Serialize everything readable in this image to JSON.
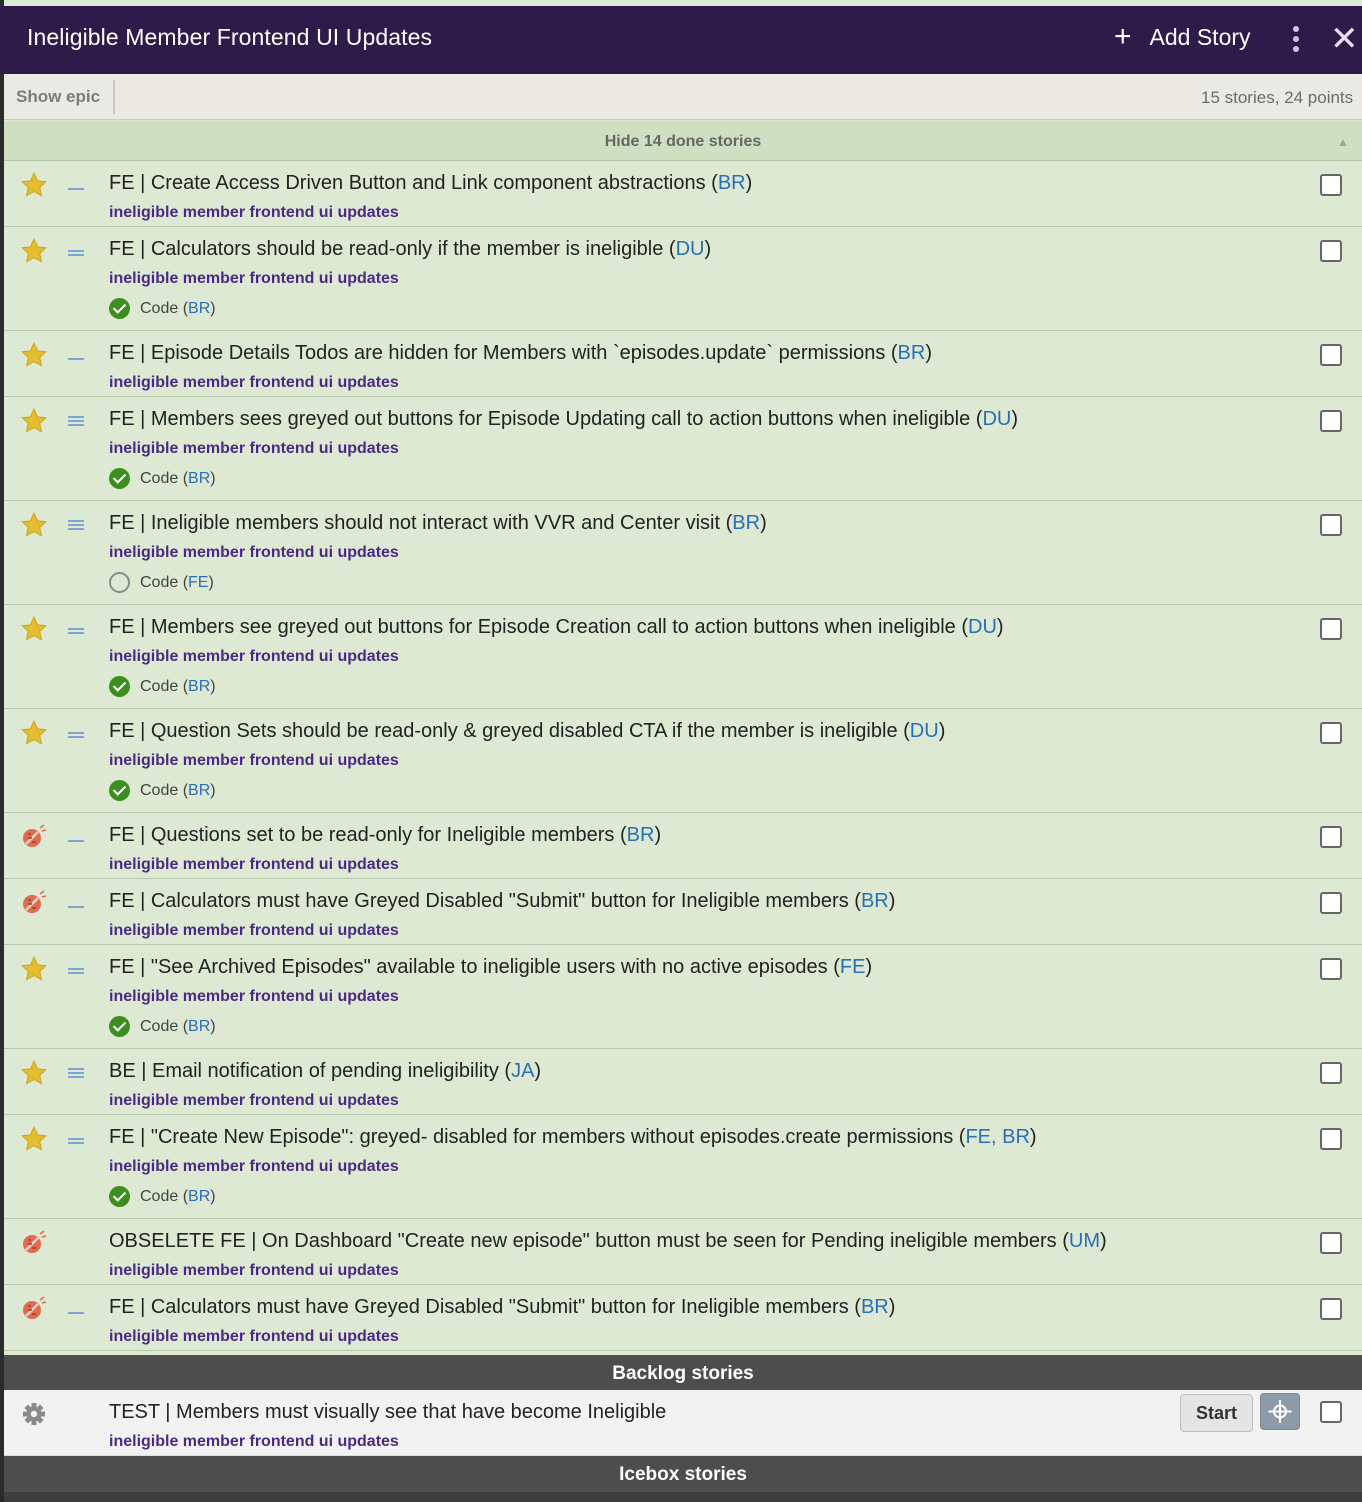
{
  "header": {
    "title": "Ineligible Member Frontend UI Updates",
    "add_story_label": "Add Story",
    "add_icon": "plus-icon",
    "menu_icon": "kebab-menu-icon",
    "close_icon": "close-icon"
  },
  "toolbar": {
    "show_epic_label": "Show epic",
    "summary": "15 stories, 24 points"
  },
  "done_section": {
    "toggle_label": "Hide 14 done stories"
  },
  "colors": {
    "header_bg": "#2f1b4a",
    "done_story_bg": "#dde9d2",
    "epic_label": "#4b2a86",
    "owner_link": "#2a6eb8",
    "task_done": "#3c8f1e",
    "section_header_bg": "#4d4d4d"
  },
  "done_stories": [
    {
      "type_icon": "star-icon",
      "estimate_lines": 1,
      "title": "FE | Create Access Driven Button and Link component abstractions",
      "owners": "BR",
      "epic": "ineligible member frontend ui updates"
    },
    {
      "type_icon": "star-icon",
      "estimate_lines": 2,
      "title": "FE | Calculators should be read-only if the member is ineligible",
      "owners": "DU",
      "epic": "ineligible member frontend ui updates",
      "task": {
        "label": "Code",
        "owner": "BR",
        "done": true
      }
    },
    {
      "type_icon": "star-icon",
      "estimate_lines": 1,
      "title": "FE | Episode Details Todos are hidden for Members with `episodes.update` permissions",
      "owners": "BR",
      "epic": "ineligible member frontend ui updates"
    },
    {
      "type_icon": "star-icon",
      "estimate_lines": 3,
      "title": "FE | Members sees greyed out buttons for Episode Updating call to action buttons when ineligible ",
      "owners": "DU",
      "epic": "ineligible member frontend ui updates",
      "task": {
        "label": "Code",
        "owner": "BR",
        "done": true
      }
    },
    {
      "type_icon": "star-icon",
      "estimate_lines": 3,
      "title": "FE | Ineligible members should not interact with VVR and Center visit ",
      "owners": "BR",
      "epic": "ineligible member frontend ui updates",
      "task": {
        "label": "Code",
        "owner": "FE",
        "done": false
      }
    },
    {
      "type_icon": "star-icon",
      "estimate_lines": 2,
      "title": "FE | Members see greyed out buttons for Episode Creation call to action buttons when ineligible",
      "owners": "DU",
      "epic": "ineligible member frontend ui updates",
      "task": {
        "label": "Code",
        "owner": "BR",
        "done": true
      }
    },
    {
      "type_icon": "star-icon",
      "estimate_lines": 2,
      "title": "FE | Question Sets should be read-only & greyed disabled CTA if the member is ineligible",
      "owners": "DU",
      "epic": "ineligible member frontend ui updates",
      "task": {
        "label": "Code",
        "owner": "BR",
        "done": true
      }
    },
    {
      "type_icon": "bug-icon",
      "estimate_lines": 1,
      "title": "FE | Questions set to be read-only for Ineligible members",
      "owners": "BR",
      "epic": "ineligible member frontend ui updates"
    },
    {
      "type_icon": "bug-icon",
      "estimate_lines": 1,
      "title": "FE | Calculators must have Greyed Disabled \"Submit\" button for Ineligible members",
      "owners": "BR",
      "epic": "ineligible member frontend ui updates"
    },
    {
      "type_icon": "star-icon",
      "estimate_lines": 2,
      "title": "FE | \"See Archived Episodes\" available to ineligible users with no active episodes",
      "owners": "FE",
      "epic": "ineligible member frontend ui updates",
      "task": {
        "label": "Code",
        "owner": "BR",
        "done": true
      }
    },
    {
      "type_icon": "star-icon",
      "estimate_lines": 3,
      "title": "BE | Email notification of pending ineligibility",
      "owners": "JA",
      "epic": "ineligible member frontend ui updates"
    },
    {
      "type_icon": "star-icon",
      "estimate_lines": 2,
      "title": "FE | \"Create New Episode\": greyed- disabled for members without episodes.create permissions",
      "owners": "FE, BR",
      "epic": "ineligible member frontend ui updates",
      "task": {
        "label": "Code",
        "owner": "BR",
        "done": true
      }
    },
    {
      "type_icon": "bug-icon",
      "estimate_lines": 0,
      "title": "OBSELETE FE | On Dashboard \"Create new episode\" button must be seen for Pending ineligible members",
      "owners": "UM",
      "epic": "ineligible member frontend ui updates"
    },
    {
      "type_icon": "bug-icon",
      "estimate_lines": 1,
      "title": "FE | Calculators must have Greyed Disabled \"Submit\" button for Ineligible members",
      "owners": "BR",
      "epic": "ineligible member frontend ui updates"
    }
  ],
  "backlog": {
    "header": "Backlog stories",
    "stories": [
      {
        "type_icon": "chore-gear-icon",
        "title": "TEST | Members must visually see that have become Ineligible",
        "epic": "ineligible member frontend ui updates",
        "start_label": "Start",
        "move_icon": "move-crosshair-icon"
      }
    ]
  },
  "icebox": {
    "header": "Icebox stories"
  }
}
